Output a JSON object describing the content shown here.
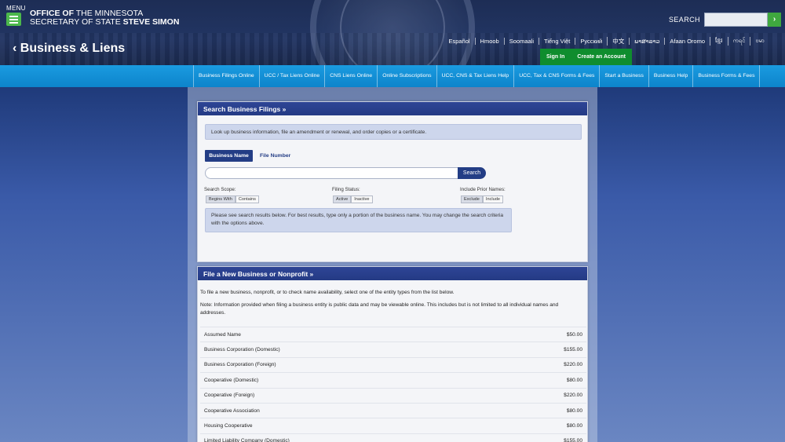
{
  "header": {
    "menu_label": "MENU",
    "logo_line1_bold": "OFFICE OF",
    "logo_line1_rest": " THE MINNESOTA",
    "logo_line2_rest": "SECRETARY OF STATE ",
    "logo_line2_bold": "STEVE SIMON",
    "search_label": "SEARCH",
    "search_go": "›",
    "section_title": "Business & Liens",
    "section_back": "‹",
    "sign_in": "Sign In",
    "create_account": "Create an Account"
  },
  "languages": [
    "Español",
    "Hmoob",
    "Soomaali",
    "Tiếng Việt",
    "Русский",
    "中文",
    "ພາສາລາວ",
    "Afaan Oromo",
    "ខ្មែរ",
    "ကရင်",
    "ဗမာ"
  ],
  "nav": [
    "Business Filings Online",
    "UCC / Tax Liens Online",
    "CNS Liens Online",
    "Online Subscriptions",
    "UCC, CNS & Tax Liens Help",
    "UCC, Tax & CNS Forms & Fees",
    "Start a Business",
    "Business Help",
    "Business Forms & Fees"
  ],
  "search_panel": {
    "title": "Search Business Filings »",
    "intro": "Look up business information, file an amendment or renewal, and order copies or a certificate.",
    "tab_business_name": "Business Name",
    "tab_file_number": "File Number",
    "search_button": "Search",
    "scope_label": "Search Scope:",
    "scope_options": [
      "Begins With",
      "Contains"
    ],
    "status_label": "Filing Status:",
    "status_options": [
      "Active",
      "Inactive"
    ],
    "prior_label": "Include Prior Names:",
    "prior_options": [
      "Exclude",
      "Include"
    ],
    "notice": "Please see search results below. For best results, type only a portion of the business name. You may change the search criteria with the options above."
  },
  "file_panel": {
    "title": "File a New Business or Nonprofit »",
    "intro": "To file a new business, nonprofit, or to check name availability, select one of the entity types from the list below.",
    "note": "Note: Information provided when filing a business entity is public data and may be viewable online. This includes but is not limited to all individual names and addresses.",
    "fees": [
      {
        "name": "Assumed Name",
        "fee": "$50.00"
      },
      {
        "name": "Business Corporation (Domestic)",
        "fee": "$155.00"
      },
      {
        "name": "Business Corporation (Foreign)",
        "fee": "$220.00"
      },
      {
        "name": "Cooperative (Domestic)",
        "fee": "$80.00"
      },
      {
        "name": "Cooperative (Foreign)",
        "fee": "$220.00"
      },
      {
        "name": "Cooperative Association",
        "fee": "$80.00"
      },
      {
        "name": "Housing Cooperative",
        "fee": "$80.00"
      },
      {
        "name": "Limited Liability Company (Domestic)",
        "fee": "$155.00"
      }
    ]
  }
}
